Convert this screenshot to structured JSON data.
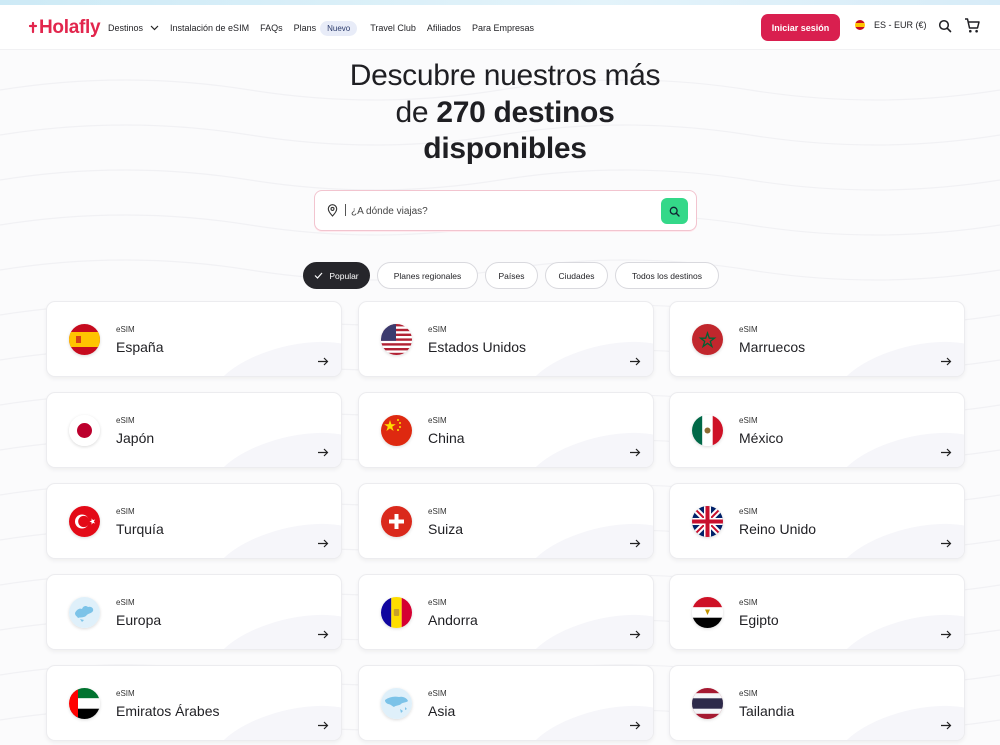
{
  "brand": {
    "logo_mark": "·",
    "logo_text": "Holafly",
    "accent": "#e2264d"
  },
  "nav": {
    "destinos": "Destinos",
    "instalacion": "Instalación de eSIM",
    "faqs": "FAQs",
    "plans": "Plans",
    "plans_badge": "Nuevo",
    "travel_club": "Travel Club",
    "afiliados": "Afiliados",
    "empresas": "Para Empresas"
  },
  "header": {
    "login_label": "Iniciar sesión",
    "language_currency": "ES - EUR (€)",
    "search_icon": "search-icon",
    "cart_icon": "cart-icon"
  },
  "hero": {
    "line1": "Descubre nuestros más",
    "line2_prefix": "de ",
    "line2_bold": "270 destinos",
    "line3": "disponibles"
  },
  "search": {
    "placeholder": "¿A dónde viajas?"
  },
  "filters": [
    {
      "label": "Popular",
      "active": true
    },
    {
      "label": "Planes regionales",
      "active": false
    },
    {
      "label": "Países",
      "active": false
    },
    {
      "label": "Ciudades",
      "active": false
    },
    {
      "label": "Todos los destinos",
      "active": false
    }
  ],
  "cards": [
    {
      "type": "eSIM",
      "name": "España",
      "flag": "spain-flag"
    },
    {
      "type": "eSIM",
      "name": "Estados Unidos",
      "flag": "usa-flag"
    },
    {
      "type": "eSIM",
      "name": "Marruecos",
      "flag": "morocco-flag"
    },
    {
      "type": "eSIM",
      "name": "Japón",
      "flag": "japan-flag"
    },
    {
      "type": "eSIM",
      "name": "China",
      "flag": "china-flag"
    },
    {
      "type": "eSIM",
      "name": "México",
      "flag": "mexico-flag"
    },
    {
      "type": "eSIM",
      "name": "Turquía",
      "flag": "turkey-flag"
    },
    {
      "type": "eSIM",
      "name": "Suiza",
      "flag": "switzerland-flag"
    },
    {
      "type": "eSIM",
      "name": "Reino Unido",
      "flag": "uk-flag"
    },
    {
      "type": "eSIM",
      "name": "Europa",
      "flag": "europe-map-icon"
    },
    {
      "type": "eSIM",
      "name": "Andorra",
      "flag": "andorra-flag"
    },
    {
      "type": "eSIM",
      "name": "Egipto",
      "flag": "egypt-flag"
    },
    {
      "type": "eSIM",
      "name": "Emiratos Árabes",
      "flag": "uae-flag"
    },
    {
      "type": "eSIM",
      "name": "Asia",
      "flag": "asia-map-icon"
    },
    {
      "type": "eSIM",
      "name": "Tailandia",
      "flag": "thailand-flag"
    }
  ]
}
